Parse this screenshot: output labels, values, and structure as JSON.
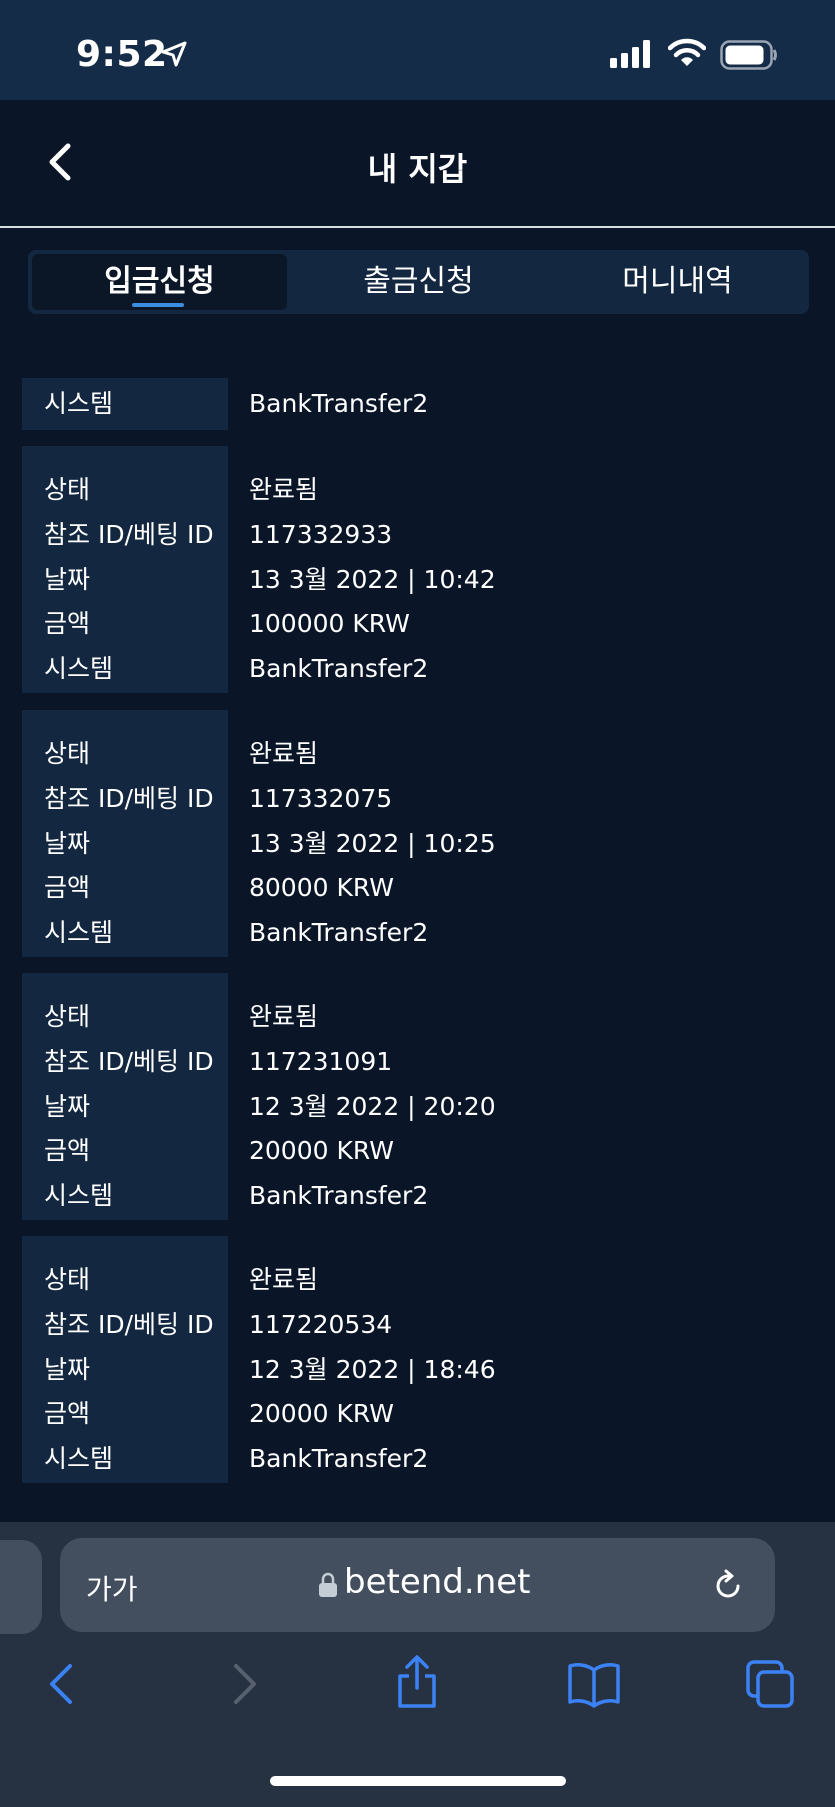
{
  "status": {
    "time": "9:52"
  },
  "header": {
    "title": "내 지갑"
  },
  "tabs": [
    {
      "label": "입금신청"
    },
    {
      "label": "출금신청"
    },
    {
      "label": "머니내역"
    }
  ],
  "system_row": {
    "label": "시스템",
    "value": "BankTransfer2"
  },
  "field_labels": {
    "status": "상태",
    "ref": "참조 ID/베팅 ID",
    "date": "날짜",
    "amount": "금액",
    "system": "시스템"
  },
  "records": [
    {
      "status": "완료됨",
      "ref": "117332933",
      "date": "13 3월 2022 | 10:42",
      "amount": "100000 KRW",
      "system": "BankTransfer2"
    },
    {
      "status": "완료됨",
      "ref": "117332075",
      "date": "13 3월 2022 | 10:25",
      "amount": "80000 KRW",
      "system": "BankTransfer2"
    },
    {
      "status": "완료됨",
      "ref": "117231091",
      "date": "12 3월 2022 | 20:20",
      "amount": "20000 KRW",
      "system": "BankTransfer2"
    },
    {
      "status": "완료됨",
      "ref": "117220534",
      "date": "12 3월 2022 | 18:46",
      "amount": "20000 KRW",
      "system": "BankTransfer2"
    }
  ],
  "browser": {
    "aa_label": "가가",
    "url": "betend.net"
  },
  "colors": {
    "accent": "#3a8de0",
    "background": "#0a1628",
    "label_bg": "#132840",
    "safari_blue": "#3b82f6"
  }
}
